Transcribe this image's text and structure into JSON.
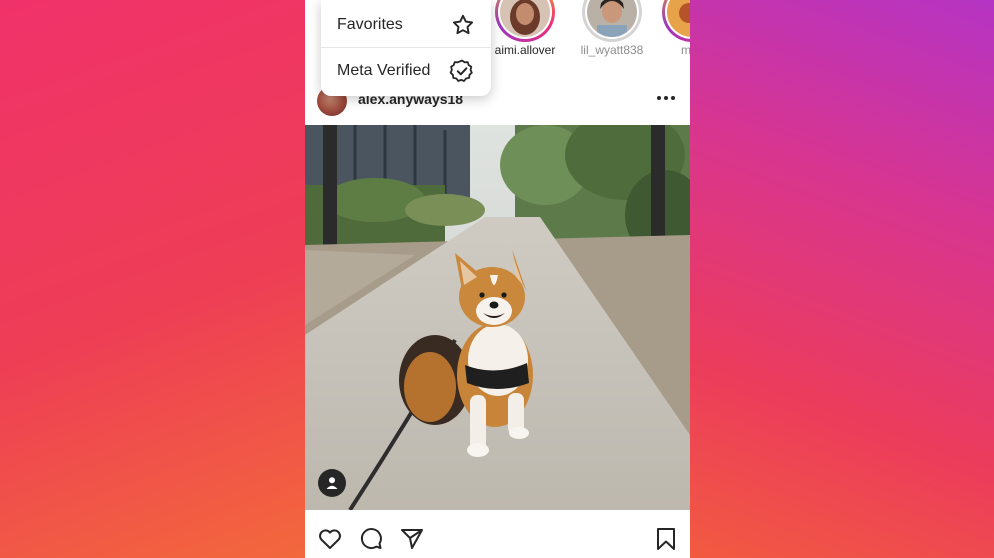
{
  "stories": [
    {
      "username": "aimi.allover",
      "seen": false
    },
    {
      "username": "lil_wyatt838",
      "seen": true
    },
    {
      "username": "mist",
      "seen": false
    }
  ],
  "menu": {
    "items": [
      {
        "label": "Favorites",
        "icon": "star-icon"
      },
      {
        "label": "Meta Verified",
        "icon": "verified-badge-icon"
      }
    ]
  },
  "post": {
    "username": "alex.anyways18",
    "image": "corgi-on-leash-photo"
  },
  "colors": {
    "story_ring": "#ee2a7b",
    "text": "#262626",
    "bg_left": "#f0326a",
    "bg_right": "#b534c4"
  }
}
